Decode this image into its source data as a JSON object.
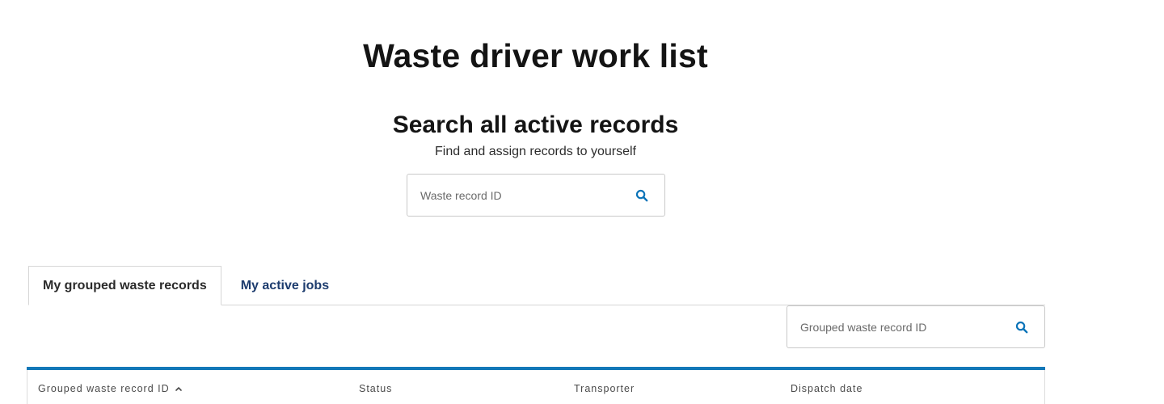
{
  "header": {
    "title": "Waste driver work list"
  },
  "search": {
    "heading": "Search all active records",
    "subtitle": "Find and assign records to yourself",
    "placeholder": "Waste record ID",
    "icon": "search-icon"
  },
  "tabs": [
    {
      "label": "My grouped waste records",
      "active": true
    },
    {
      "label": "My active jobs",
      "active": false
    }
  ],
  "grouped_search": {
    "placeholder": "Grouped waste record ID",
    "icon": "search-icon"
  },
  "table": {
    "columns": [
      {
        "label": "Grouped waste record ID",
        "sort": "ascending"
      },
      {
        "label": "Status"
      },
      {
        "label": "Transporter"
      },
      {
        "label": "Dispatch date"
      }
    ]
  },
  "colors": {
    "accent": "#1378b8",
    "tab_link": "#1d3c6e",
    "search_icon": "#0a73b8"
  }
}
